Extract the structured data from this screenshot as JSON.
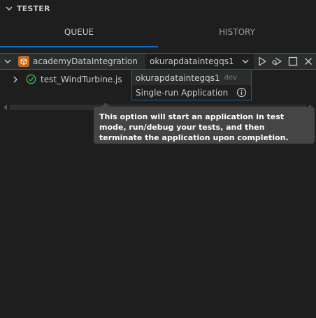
{
  "panel": {
    "title": "TESTER",
    "tabs": [
      {
        "label": "QUEUE",
        "active": true
      },
      {
        "label": "HISTORY",
        "active": false
      }
    ]
  },
  "tree": {
    "application": {
      "label": "academyDataIntegration",
      "icon": "app-package-icon",
      "environment_select": {
        "value": "okurapdataintegqs1"
      },
      "toolbar": [
        "run-icon",
        "debug-icon",
        "stop-icon",
        "close-icon"
      ]
    },
    "tests": [
      {
        "label": "test_WindTurbine.js",
        "status": "passed",
        "icon": "check-circle-icon"
      }
    ]
  },
  "dropdown": {
    "options": [
      {
        "label": "okurapdataintegqs1",
        "description": "dev"
      },
      {
        "label": "Single-run Application",
        "icon": "info-icon"
      }
    ]
  },
  "tooltip": {
    "text": "This option will start an application in test mode, run/debug your tests, and then terminate the application upon completion."
  },
  "colors": {
    "background": "#1e1e1e",
    "accent": "#0e6fc1",
    "focus_border": "#0e639c",
    "app_icon": "#c7681b",
    "pass": "#3fb950",
    "tooltip_bg": "#454545"
  }
}
